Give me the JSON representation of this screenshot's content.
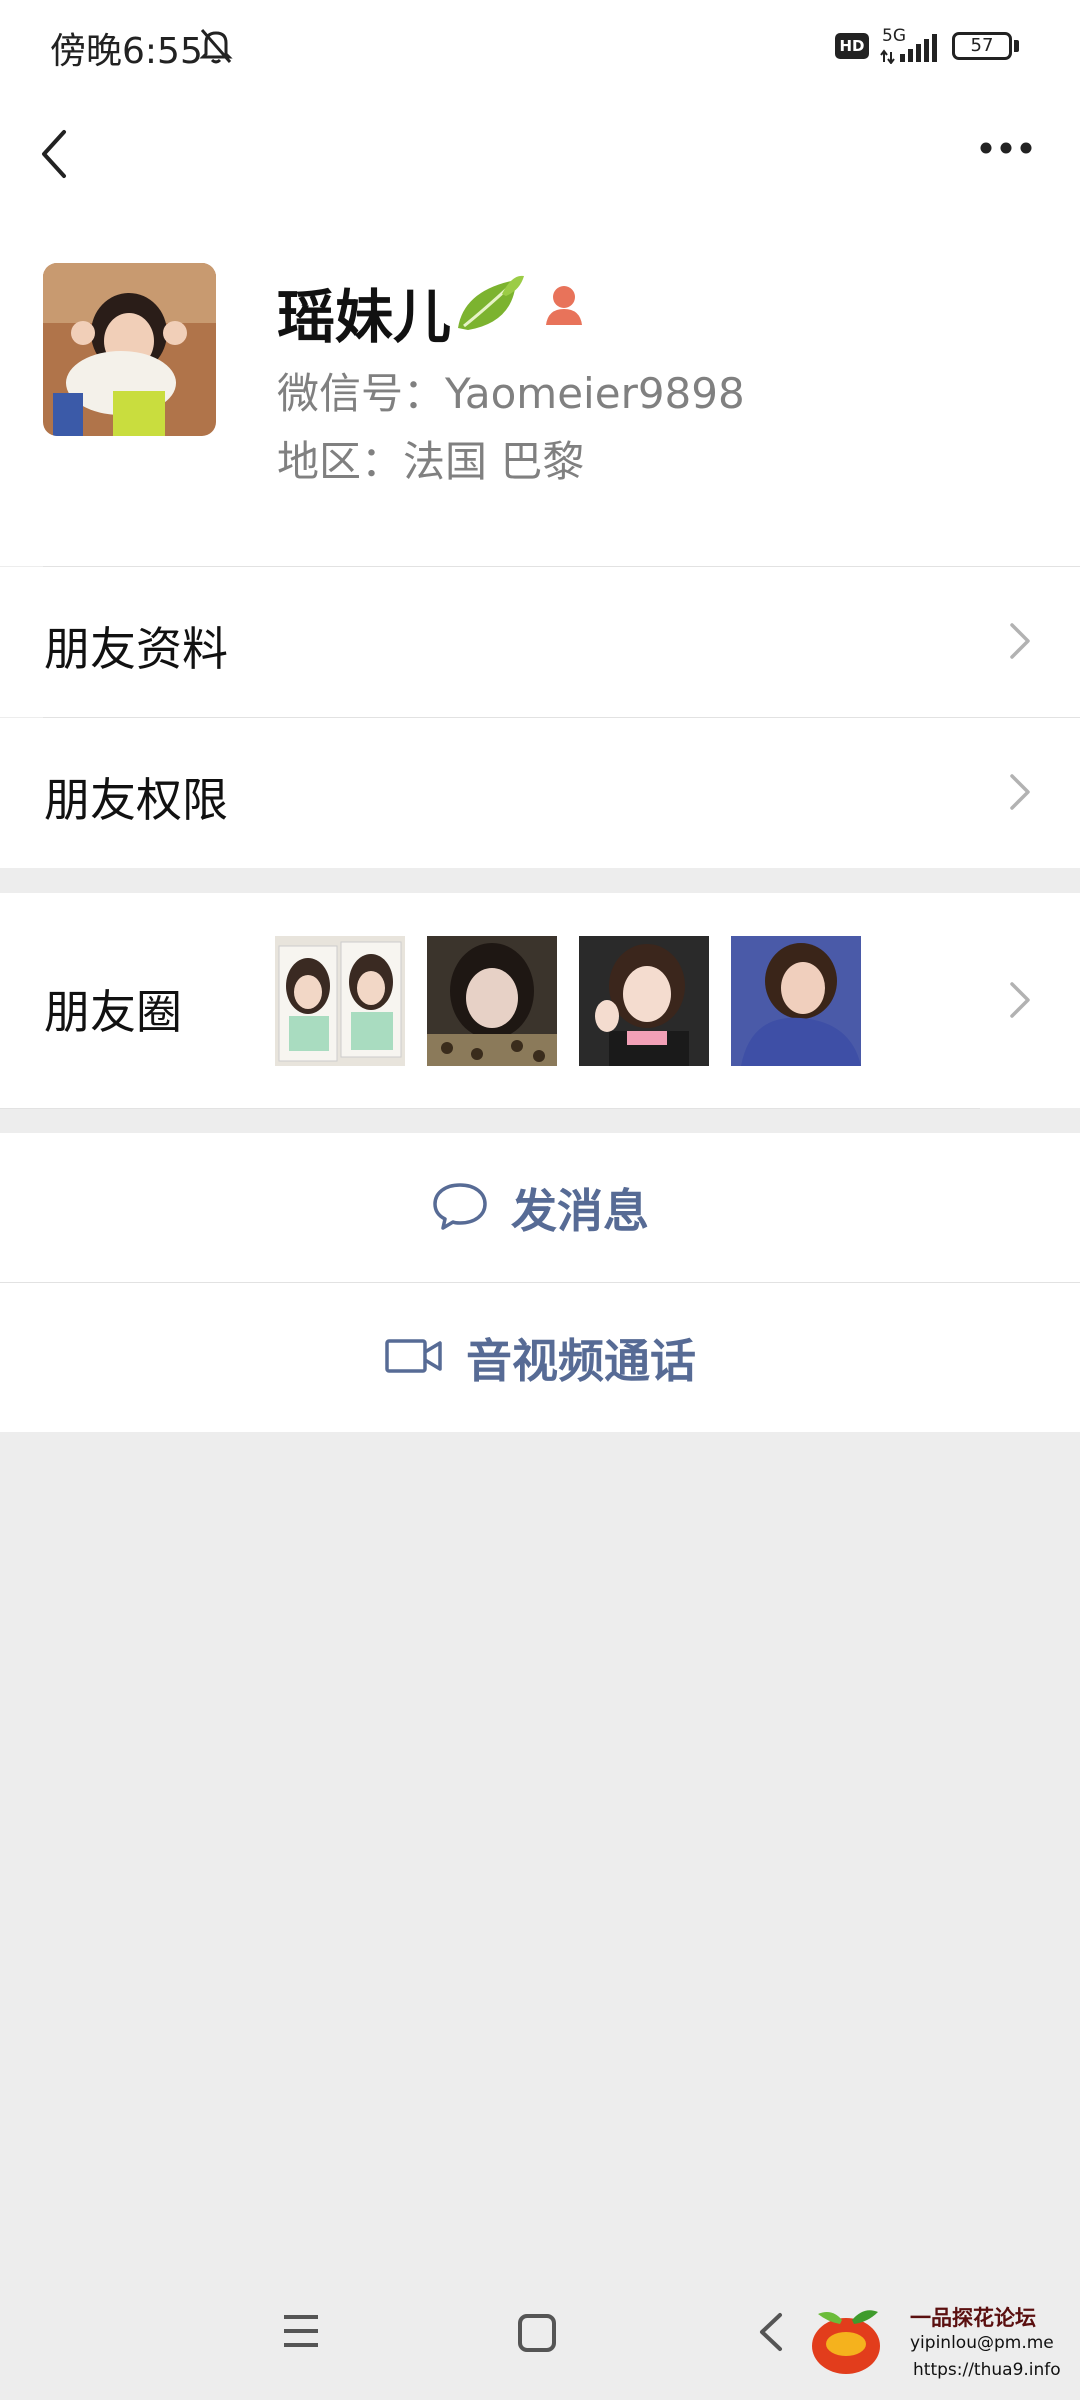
{
  "status_bar": {
    "time": "傍晚6:55",
    "hd_badge": "HD",
    "network": "5G",
    "battery": "57"
  },
  "profile": {
    "nickname": "瑶妹儿",
    "wechat_id": "微信号：Yaomeier9898",
    "region": "地区：法国  巴黎"
  },
  "rows": {
    "friend_profile": "朋友资料",
    "friend_permissions": "朋友权限",
    "moments": "朋友圈"
  },
  "actions": {
    "send_message": "发消息",
    "video_call": "音视频通话"
  },
  "watermark": {
    "title": "一品探花论坛",
    "email": "yipinlou@pm.me",
    "url": "https://thua9.info"
  },
  "colors": {
    "link_blue": "#576b95",
    "gender_icon": "#e8735a"
  },
  "icons": [
    "bell-off-icon",
    "signal-icon",
    "battery-icon",
    "back-icon",
    "more-icon",
    "leaf-icon",
    "gender-icon",
    "chevron-right-icon",
    "chat-bubble-icon",
    "video-camera-icon",
    "menu-icon",
    "home-icon",
    "back-nav-icon"
  ]
}
